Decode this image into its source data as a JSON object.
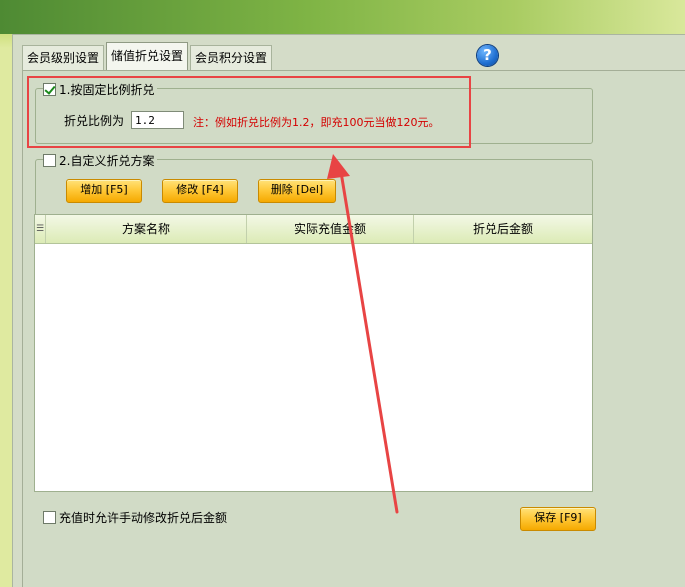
{
  "tabs": [
    {
      "label": "会员级别设置"
    },
    {
      "label": "储值折兑设置"
    },
    {
      "label": "会员积分设置"
    }
  ],
  "help": {
    "glyph": "?"
  },
  "fixed_ratio": {
    "legend": "1.按固定比例折兑",
    "checked": true,
    "ratio_label": "折兑比例为",
    "ratio_value": "1.2",
    "note": "注：例如折兑比例为1.2，即充100元当做120元。"
  },
  "custom_scheme": {
    "legend": "2.自定义折兑方案",
    "checked": false,
    "buttons": {
      "add": "增加 [F5]",
      "edit": "修改 [F4]",
      "delete": "删除 [Del]"
    },
    "table": {
      "handle_glyph": "☰",
      "columns": [
        "方案名称",
        "实际充值金额",
        "折兑后金额"
      ],
      "rows": []
    }
  },
  "allow_manual": {
    "label": "充值时允许手动修改折兑后金额",
    "checked": false
  },
  "save_button": "保存 [F9]",
  "colors": {
    "highlight_frame": "#e84444",
    "note_text": "#d40000",
    "button_orange": "#ffc93a"
  }
}
